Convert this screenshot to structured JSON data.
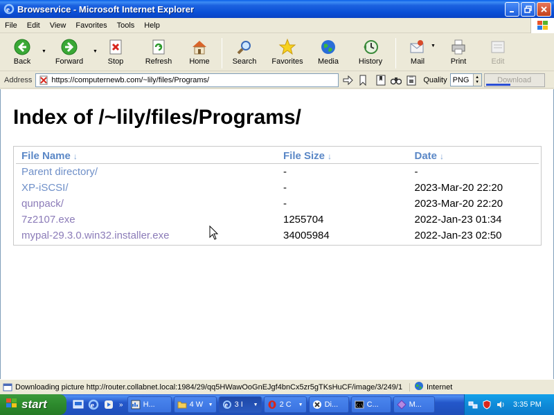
{
  "window": {
    "title": "Browservice - Microsoft Internet Explorer"
  },
  "menu": [
    "File",
    "Edit",
    "View",
    "Favorites",
    "Tools",
    "Help"
  ],
  "toolbar": {
    "back": "Back",
    "forward": "Forward",
    "stop": "Stop",
    "refresh": "Refresh",
    "home": "Home",
    "search": "Search",
    "favorites": "Favorites",
    "media": "Media",
    "history": "History",
    "mail": "Mail",
    "print": "Print",
    "edit": "Edit"
  },
  "address": {
    "label": "Address",
    "url": "https://computernewb.com/~lily/files/Programs/",
    "quality_label": "Quality",
    "quality_value": "PNG",
    "download_label": "Download",
    "download_progress": 0.42
  },
  "page": {
    "heading": "Index of /~lily/files/Programs/",
    "columns": {
      "name": "File Name",
      "size": "File Size",
      "date": "Date",
      "sort_arrow": "↓"
    },
    "rows": [
      {
        "name": "Parent directory/",
        "size": "-",
        "date": "-"
      },
      {
        "name": "XP-iSCSI/",
        "size": "-",
        "date": "2023-Mar-20 22:20"
      },
      {
        "name": "qunpack/",
        "size": "-",
        "date": "2023-Mar-20 22:20"
      },
      {
        "name": "7z2107.exe",
        "size": "1255704",
        "date": "2022-Jan-23 01:34"
      },
      {
        "name": "mypal-29.3.0.win32.installer.exe",
        "size": "34005984",
        "date": "2022-Jan-23 02:50"
      }
    ]
  },
  "status": {
    "text": "Downloading picture http://router.collabnet.local:1984/29/qq5HWawOoGnEJgf4bnCx5zr5gTKsHuCF/image/3/249/1",
    "zone": "Internet"
  },
  "taskbar": {
    "start": "start",
    "tasks": [
      {
        "label": "H...",
        "icon": "app-icon"
      },
      {
        "label": "4 W",
        "icon": "folder-icon",
        "dropdown": true
      },
      {
        "label": "3 I",
        "icon": "ie-icon",
        "dropdown": true,
        "active": true
      },
      {
        "label": "2 C",
        "icon": "opera-icon",
        "dropdown": true
      },
      {
        "label": "Di...",
        "icon": "app-icon"
      },
      {
        "label": "C...",
        "icon": "console-icon"
      },
      {
        "label": "M...",
        "icon": "app-icon"
      }
    ],
    "clock": "3:35 PM"
  },
  "colors": {
    "title_bar": "#0a4fd6",
    "taskbar": "#2457ca",
    "start": "#2d8a2d",
    "link": "#8b7bb8",
    "header_link": "#5a87c6"
  }
}
